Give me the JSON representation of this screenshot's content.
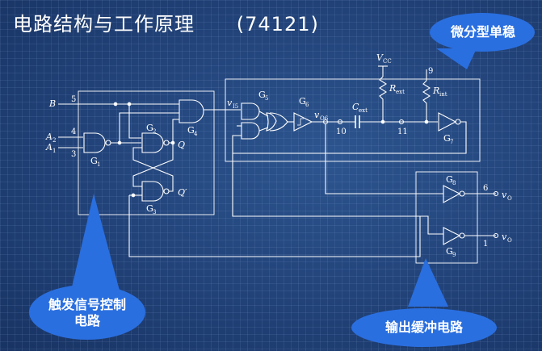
{
  "slide": {
    "title": "电路结构与工作原理      (74121)"
  },
  "callouts": {
    "monostable": "微分型单稳",
    "trigger_line1": "触发信号控制",
    "trigger_line2": "电路",
    "buffer": "输出缓冲电路"
  },
  "pins": {
    "B": "B",
    "B_num": "5",
    "A2": "A",
    "A2_sub": "2",
    "A2_num": "4",
    "A1": "A",
    "A1_sub": "1",
    "A1_num": "3",
    "p10": "10",
    "p11": "11",
    "p9": "9",
    "p6": "6",
    "p1": "1"
  },
  "gates": {
    "G1": "G",
    "G1_sub": "1",
    "G2": "G",
    "G2_sub": "2",
    "G3": "G",
    "G3_sub": "3",
    "G4": "G",
    "G4_sub": "4",
    "G5": "G",
    "G5_sub": "5",
    "G6": "G",
    "G6_sub": "6",
    "G7": "G",
    "G7_sub": "7",
    "G8": "G",
    "G8_sub": "8",
    "G9": "G",
    "G9_sub": "9"
  },
  "signals": {
    "Q": "Q",
    "Qbar": "Q′",
    "vI5": "v",
    "vI5_sub": "I5",
    "vO6": "v",
    "vO6_sub": "O6",
    "vO": "v",
    "vO_sub": "O",
    "vObar": "v",
    "vObar_sub": "O",
    "Vcc": "V",
    "Vcc_sub": "CC",
    "Cext": "C",
    "Cext_sub": "ext",
    "Rext": "R",
    "Rext_sub": "ext",
    "Rint": "R",
    "Rint_sub": "int"
  },
  "colors": {
    "background": "#23457c",
    "line": "#ffffff",
    "callout_fill": "#2a6fe0",
    "callout_stroke": "#9cc3ff"
  }
}
